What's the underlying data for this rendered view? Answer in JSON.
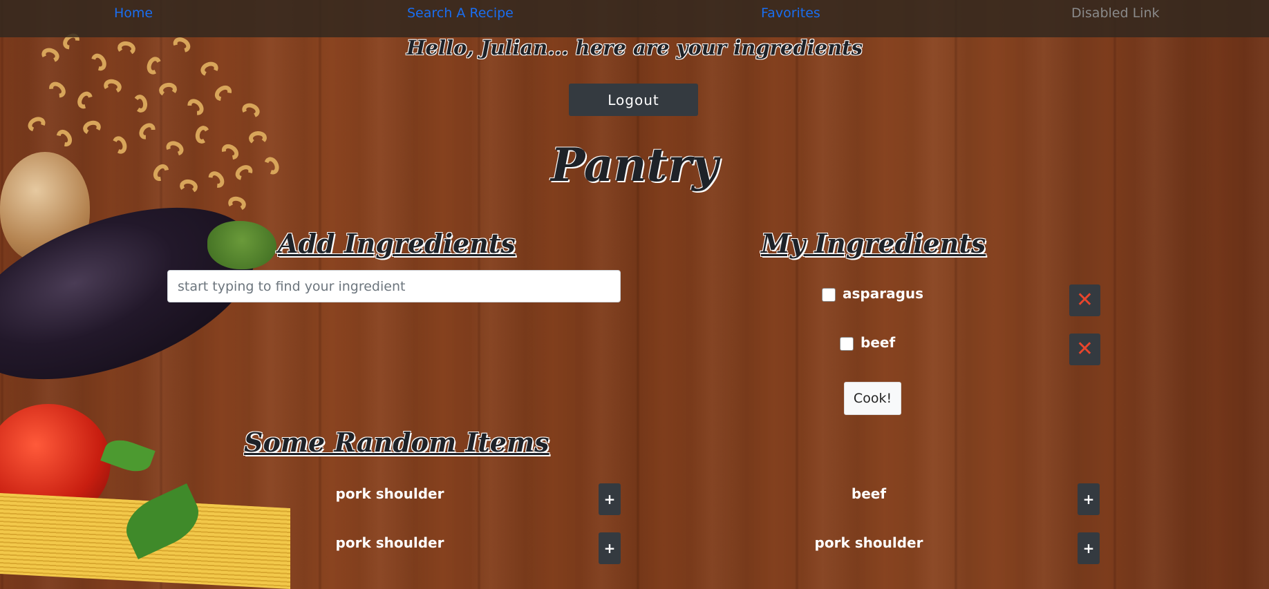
{
  "nav": {
    "home": "Home",
    "search": "Search A Recipe",
    "favorites": "Favorites",
    "disabled": "Disabled Link"
  },
  "greeting": "Hello, Julian... here are your ingredients",
  "logout_label": "Logout",
  "page_title": "Pantry",
  "add_section": {
    "title": "Add Ingredients",
    "search_placeholder": "start typing to find your ingredient"
  },
  "my_section": {
    "title": "My Ingredients",
    "items": [
      {
        "label": "asparagus",
        "delete_icon": "close-icon"
      },
      {
        "label": "beef",
        "delete_icon": "close-icon"
      }
    ],
    "cook_label": "Cook!"
  },
  "random_section": {
    "title": "Some Random Items",
    "left": [
      "pork shoulder",
      "pork shoulder"
    ],
    "right": [
      "beef",
      "pork shoulder"
    ],
    "add_label": "+"
  },
  "colors": {
    "nav_link": "#1a6ef0",
    "dark_button": "#343a40",
    "delete_x": "#e8452c"
  }
}
